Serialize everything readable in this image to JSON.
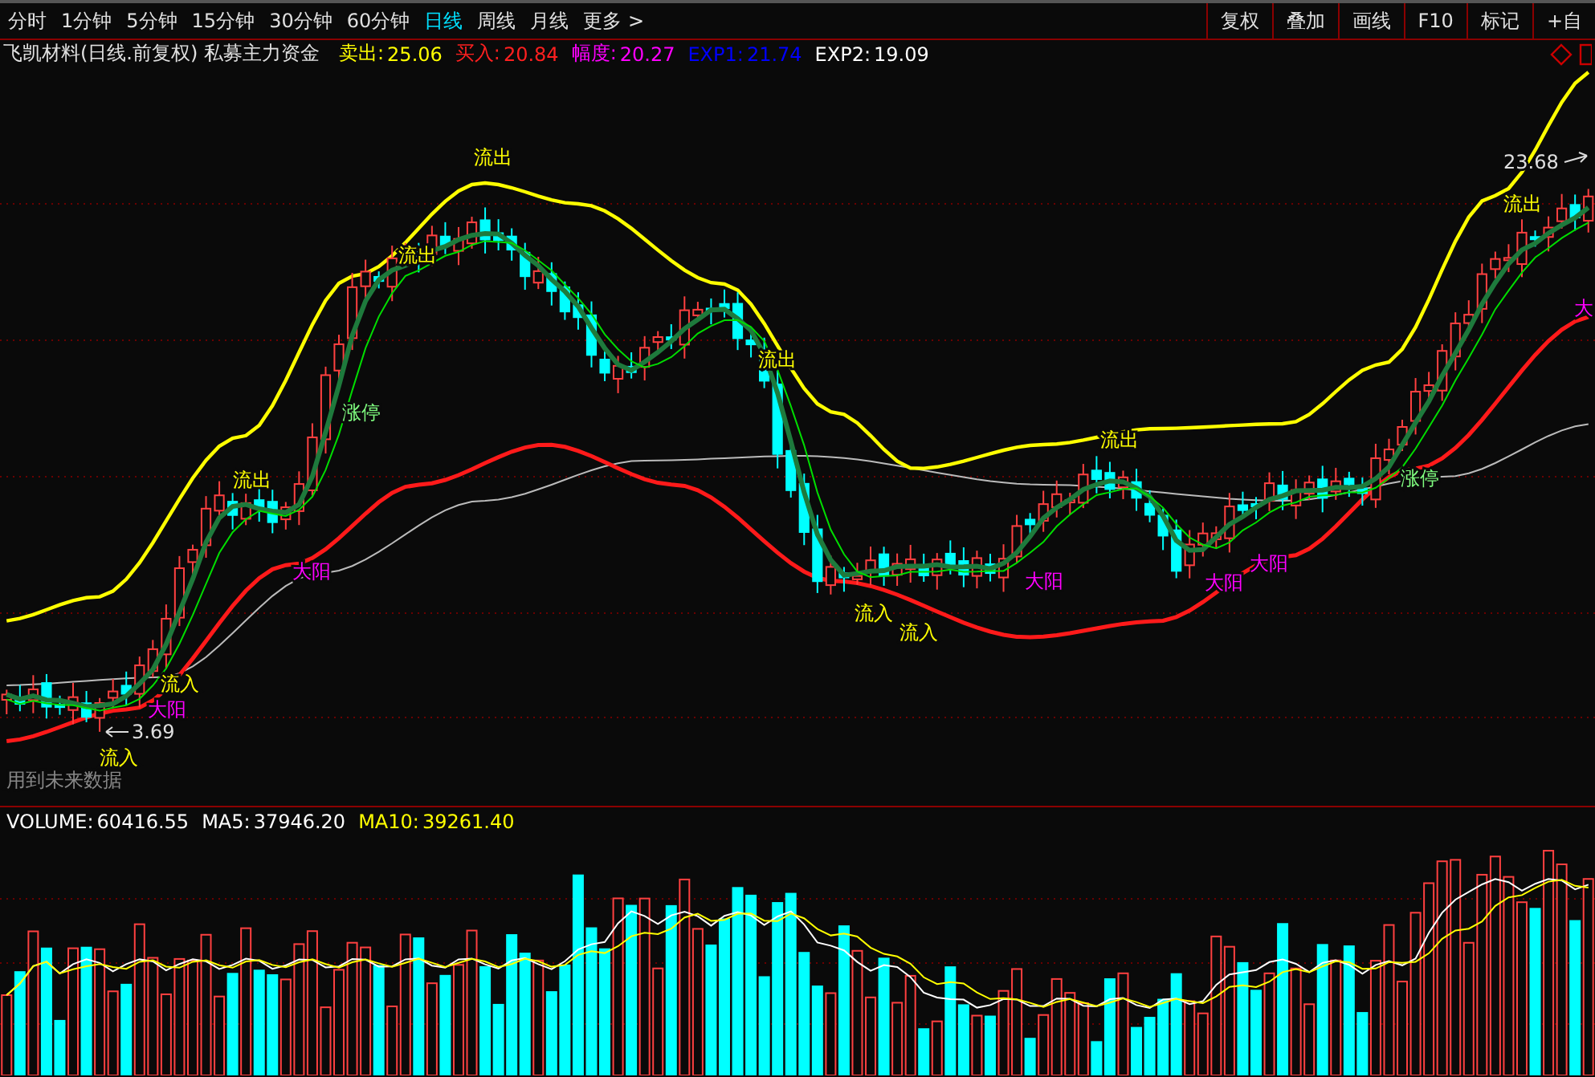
{
  "periods": [
    {
      "label": "分时",
      "selected": false
    },
    {
      "label": "1分钟",
      "selected": false
    },
    {
      "label": "5分钟",
      "selected": false
    },
    {
      "label": "15分钟",
      "selected": false
    },
    {
      "label": "30分钟",
      "selected": false
    },
    {
      "label": "60分钟",
      "selected": false
    },
    {
      "label": "日线",
      "selected": true
    },
    {
      "label": "周线",
      "selected": false
    },
    {
      "label": "月线",
      "selected": false
    },
    {
      "label": "更多 >",
      "selected": false
    }
  ],
  "tools": [
    "复权",
    "叠加",
    "画线",
    "F10",
    "标记",
    "+自"
  ],
  "info": {
    "title": "飞凯材料(日线.前复权) 私募主力资金",
    "readings": [
      {
        "label": "卖出:",
        "value": "25.06",
        "color": "#ffff00"
      },
      {
        "label": "买入:",
        "value": "20.84",
        "color": "#ff2020"
      },
      {
        "label": "幅度:",
        "value": "20.27",
        "color": "#ff00ff"
      },
      {
        "label": "EXP1:",
        "value": "21.74",
        "color": "#0000ff"
      },
      {
        "label": "EXP2:",
        "value": "19.09",
        "color": "#ffffff"
      }
    ]
  },
  "annotations": [
    {
      "text": "流出",
      "kind": "flow"
    },
    {
      "text": "流出",
      "kind": "flow"
    },
    {
      "text": "流出",
      "kind": "flow"
    },
    {
      "text": "流出",
      "kind": "flow"
    },
    {
      "text": "流出",
      "kind": "flow"
    },
    {
      "text": "流出",
      "kind": "flow"
    },
    {
      "text": "流入",
      "kind": "flow"
    },
    {
      "text": "流入",
      "kind": "flow"
    },
    {
      "text": "流入",
      "kind": "flow"
    },
    {
      "text": "流入",
      "kind": "flow"
    },
    {
      "text": "大阳",
      "kind": "big_yang"
    },
    {
      "text": "大阳",
      "kind": "big_yang"
    },
    {
      "text": "大阳",
      "kind": "big_yang"
    },
    {
      "text": "大阳",
      "kind": "big_yang"
    },
    {
      "text": "大阳",
      "kind": "big_yang"
    },
    {
      "text": "大",
      "kind": "big_yang"
    },
    {
      "text": "涨停",
      "kind": "limit_up"
    },
    {
      "text": "涨停",
      "kind": "limit_up"
    },
    {
      "text": "23.68",
      "kind": "price"
    },
    {
      "text": "3.69",
      "kind": "price"
    }
  ],
  "note": "用到未来数据",
  "volume": {
    "readings": [
      {
        "label": "VOLUME:",
        "value": "60416.55",
        "color": "#ffffff"
      },
      {
        "label": "MA5:",
        "value": "37946.20",
        "color": "#ffffff"
      },
      {
        "label": "MA10:",
        "value": "39261.40",
        "color": "#ffff00"
      }
    ]
  }
}
